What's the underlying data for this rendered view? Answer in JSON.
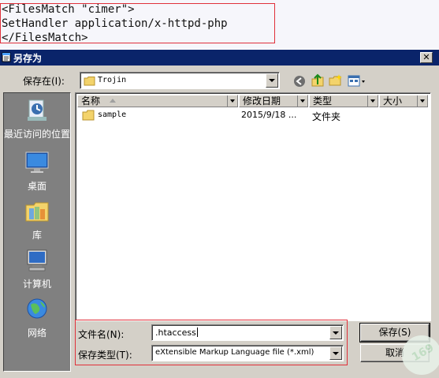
{
  "code": {
    "lines": [
      "<FilesMatch \"cimer\">",
      "SetHandler application/x-httpd-php",
      "</FilesMatch>"
    ]
  },
  "dialog": {
    "title": "另存为",
    "save_in_label": "保存在(I):",
    "save_in_value": "Trojin",
    "places": [
      {
        "label": "最近访问的位置",
        "icon": "recent-places-icon"
      },
      {
        "label": "桌面",
        "icon": "desktop-icon"
      },
      {
        "label": "库",
        "icon": "libraries-icon"
      },
      {
        "label": "计算机",
        "icon": "computer-icon"
      },
      {
        "label": "网络",
        "icon": "network-icon"
      }
    ],
    "columns": [
      "名称",
      "修改日期",
      "类型",
      "大小"
    ],
    "files": [
      {
        "name": "sample",
        "date": "2015/9/18 ...",
        "type": "文件夹",
        "size": ""
      }
    ],
    "filename_label": "文件名(N):",
    "filename_value": ".htaccess",
    "filetype_label": "保存类型(T):",
    "filetype_value": "eXtensible Markup Language file (*.xml)",
    "save_button": "保存(S)",
    "cancel_button": "取消"
  },
  "watermark": "169"
}
